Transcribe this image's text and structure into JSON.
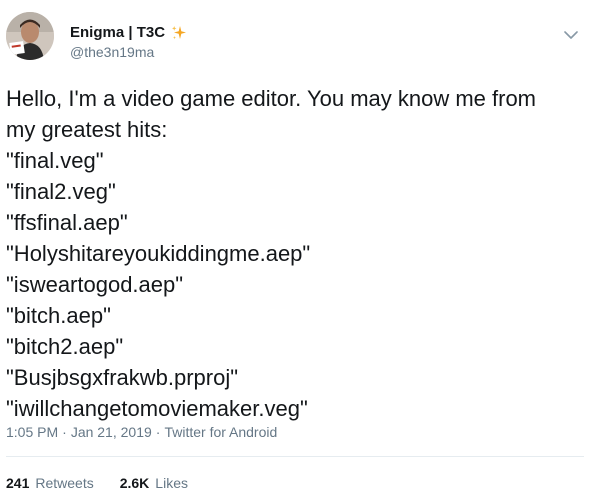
{
  "user": {
    "display_name": "Enigma | T3C",
    "handle": "@the3n19ma",
    "badge_icon": "sparkles-icon",
    "badge_color": "#f5a623"
  },
  "header": {
    "menu_icon": "chevron-down-icon"
  },
  "tweet": {
    "lines": [
      "Hello, I'm a video game editor. You may know me from",
      "my greatest hits:",
      "\"final.veg\"",
      "\"final2.veg\"",
      "\"ffsfinal.aep\"",
      "\"Holyshitareyoukiddingme.aep\"",
      "\"isweartogod.aep\"",
      "\"bitch.aep\"",
      "\"bitch2.aep\"",
      "\"Busjbsgxfrakwb.prproj\"",
      "\"iwillchangetomoviemaker.veg\""
    ],
    "time": "1:05 PM",
    "separator1": "·",
    "date": "Jan 21, 2019",
    "separator2": "·",
    "source": "Twitter for Android"
  },
  "stats": {
    "retweets_count": "241",
    "retweets_label": "Retweets",
    "likes_count": "2.6K",
    "likes_label": "Likes"
  },
  "colors": {
    "text": "#14171a",
    "secondary": "#657786",
    "divider": "#e6ecf0"
  }
}
